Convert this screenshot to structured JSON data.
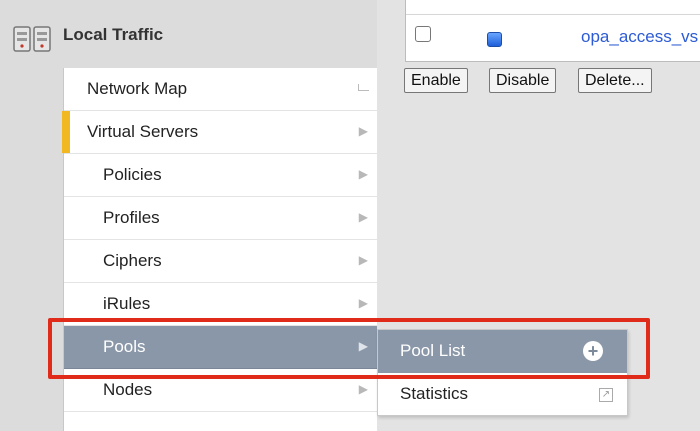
{
  "header": {
    "title": "Local Traffic",
    "icon": "local-traffic-icon"
  },
  "menu": {
    "items": [
      {
        "label": "Network Map",
        "icon": "external-icon"
      },
      {
        "label": "Virtual Servers",
        "icon": "chevron-right-icon",
        "active": true
      },
      {
        "label": "Policies",
        "icon": "chevron-right-icon"
      },
      {
        "label": "Profiles",
        "icon": "chevron-right-icon"
      },
      {
        "label": "Ciphers",
        "icon": "chevron-right-icon"
      },
      {
        "label": "iRules",
        "icon": "chevron-right-icon"
      },
      {
        "label": "Pools",
        "icon": "chevron-right-icon",
        "highlighted": true
      },
      {
        "label": "Nodes",
        "icon": "chevron-right-icon"
      }
    ]
  },
  "submenu": {
    "items": [
      {
        "label": "Pool List",
        "icon": "plus-circle-icon",
        "highlighted": true
      },
      {
        "label": "Statistics",
        "icon": "popout-icon"
      }
    ]
  },
  "table": {
    "row": {
      "name": "opa_access_vs",
      "status_color": "#2f6fe0"
    }
  },
  "buttons": {
    "enable": "Enable",
    "disable": "Disable",
    "delete": "Delete..."
  },
  "colors": {
    "highlight": "#8a97a8",
    "active_marker": "#f2b822",
    "annotation": "#e02b1a",
    "link": "#2c5bd4"
  }
}
